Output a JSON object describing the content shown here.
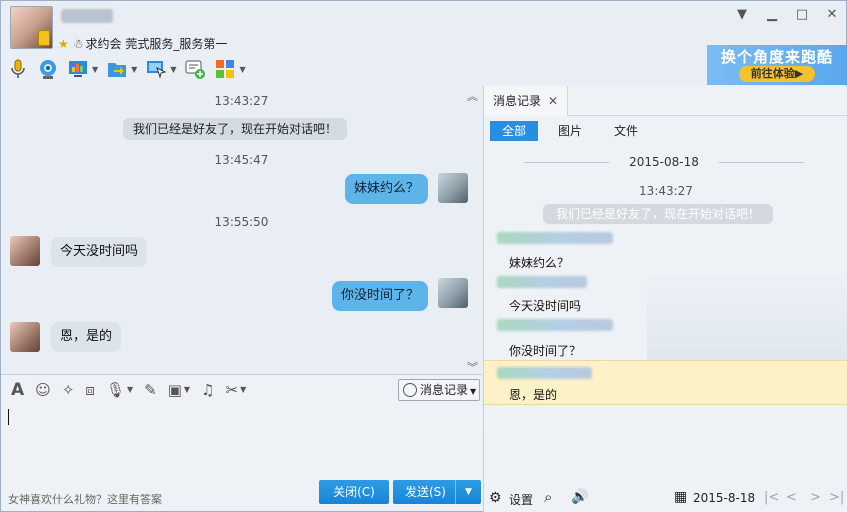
{
  "window": {
    "signature": "求约会 莞式服务_服务第一"
  },
  "toolbar_tools": [
    "mic-icon",
    "video-icon",
    "screen-share-icon",
    "file-transfer-icon",
    "remote-assist-icon",
    "invite-add-icon",
    "apps-grid-icon"
  ],
  "ad": {
    "title": "换个角度来跑酷",
    "button": "前往体验▶"
  },
  "chat": {
    "messages": [
      {
        "time": "13:43:27",
        "system": "我们已经是好友了，现在开始对话吧！"
      },
      {
        "time": "13:45:47",
        "from": "me",
        "text": "妹妹约么？"
      },
      {
        "time": "13:55:50",
        "from": "other",
        "text": "今天没时间吗"
      },
      {
        "from": "me",
        "text": "你没时间了？"
      },
      {
        "from": "other",
        "text": "恩，是的"
      }
    ]
  },
  "editor": {
    "history_button": "消息记录",
    "promo": "女神喜欢什么礼物？这里有答案",
    "close_button": "关闭(C)",
    "send_button": "发送(S)"
  },
  "history": {
    "tab": "消息记录",
    "filters": [
      "全部",
      "图片",
      "文件"
    ],
    "active_filter": "全部",
    "date": "2015-08-18",
    "time": "13:43:27",
    "system": "我们已经是好友了，现在开始对话吧！",
    "entries": [
      "妹妹约么？",
      "今天没时间吗",
      "你没时间了？",
      "恩，是的"
    ],
    "settings": "设置",
    "footer_date": "2015-8-18"
  }
}
